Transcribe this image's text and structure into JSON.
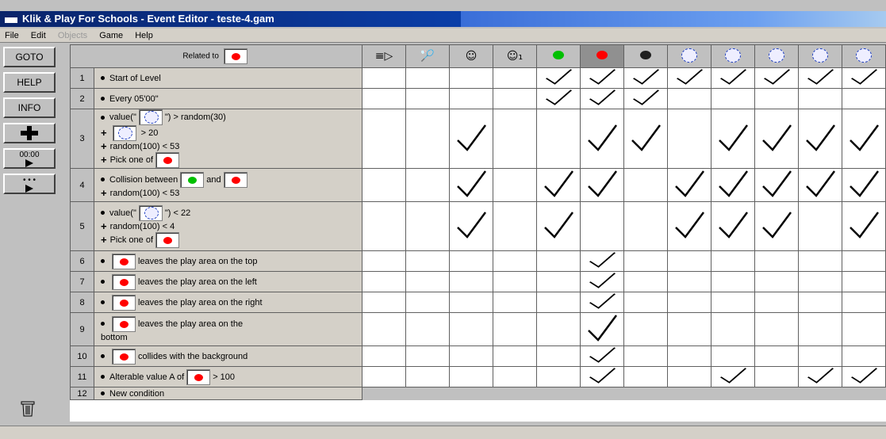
{
  "window": {
    "title": "Klik & Play For Schools - Event Editor - teste-4.gam"
  },
  "menu": [
    {
      "label": "File",
      "enabled": true
    },
    {
      "label": "Edit",
      "enabled": true
    },
    {
      "label": "Objects",
      "enabled": false
    },
    {
      "label": "Game",
      "enabled": true
    },
    {
      "label": "Help",
      "enabled": true
    }
  ],
  "toolbar": {
    "goto_label": "GOTO",
    "help_label": "HELP",
    "info_label": "INFO",
    "timer_label": "00:00",
    "dots_label": "• • •"
  },
  "header": {
    "related_to_label": "Related to"
  },
  "objects": [
    {
      "name": "speaker-icon",
      "glyph": "≡▷"
    },
    {
      "name": "racket-icon",
      "glyph": "🏸"
    },
    {
      "name": "player-icon",
      "glyph": "☺"
    },
    {
      "name": "lives-icon",
      "glyph": "☺₁"
    },
    {
      "name": "green-ball-icon",
      "color": "#00c000"
    },
    {
      "name": "red-ball-icon",
      "color": "#ff0000"
    },
    {
      "name": "black-ball-icon",
      "color": "#202020"
    },
    {
      "name": "counter-icon-1",
      "glyph": "ring"
    },
    {
      "name": "counter-icon-2",
      "glyph": "ring"
    },
    {
      "name": "counter-icon-3",
      "glyph": "ring"
    },
    {
      "name": "counter-icon-4",
      "glyph": "ring"
    },
    {
      "name": "counter-icon-5",
      "glyph": "ring"
    }
  ],
  "colors": {
    "red": "#ff0000",
    "green": "#00c000"
  },
  "rows": [
    {
      "num": "1",
      "lines": [
        {
          "prefix": "bullet",
          "parts": [
            "Start of Level"
          ]
        }
      ],
      "checks": [
        0,
        0,
        0,
        0,
        1,
        1,
        1,
        1,
        1,
        1,
        1,
        1
      ]
    },
    {
      "num": "2",
      "lines": [
        {
          "prefix": "bullet",
          "parts": [
            "Every 05'00\""
          ]
        }
      ],
      "checks": [
        0,
        0,
        0,
        0,
        1,
        1,
        1,
        0,
        0,
        0,
        0,
        0
      ]
    },
    {
      "num": "3",
      "lines": [
        {
          "prefix": "bullet",
          "parts": [
            "value(\"",
            {
              "icon": "ring"
            },
            "\") > random(30)"
          ]
        },
        {
          "prefix": "plus",
          "parts": [
            {
              "icon": "ring"
            },
            " > 20"
          ]
        },
        {
          "prefix": "plus",
          "parts": [
            "random(100) < 53"
          ]
        },
        {
          "prefix": "plus",
          "parts": [
            "Pick one of",
            {
              "icon": "red"
            }
          ]
        }
      ],
      "checks": [
        0,
        0,
        1,
        0,
        0,
        1,
        1,
        0,
        1,
        1,
        1,
        1
      ]
    },
    {
      "num": "4",
      "lines": [
        {
          "prefix": "bullet",
          "parts": [
            "Collision between",
            {
              "icon": "green"
            },
            "and",
            {
              "icon": "red"
            }
          ]
        },
        {
          "prefix": "plus",
          "parts": [
            "random(100) < 53"
          ]
        }
      ],
      "checks": [
        0,
        0,
        1,
        0,
        1,
        1,
        0,
        1,
        1,
        1,
        1,
        1
      ]
    },
    {
      "num": "5",
      "lines": [
        {
          "prefix": "bullet",
          "parts": [
            "value(\"",
            {
              "icon": "ring"
            },
            "\") < 22"
          ]
        },
        {
          "prefix": "plus",
          "parts": [
            "random(100) < 4"
          ]
        },
        {
          "prefix": "plus",
          "parts": [
            "Pick one of",
            {
              "icon": "red"
            }
          ]
        }
      ],
      "checks": [
        0,
        0,
        1,
        0,
        1,
        0,
        0,
        1,
        1,
        1,
        0,
        1
      ]
    },
    {
      "num": "6",
      "lines": [
        {
          "prefix": "bullet",
          "parts": [
            {
              "icon": "red"
            },
            "leaves the play area on the top"
          ]
        }
      ],
      "checks": [
        0,
        0,
        0,
        0,
        0,
        1,
        0,
        0,
        0,
        0,
        0,
        0
      ]
    },
    {
      "num": "7",
      "lines": [
        {
          "prefix": "bullet",
          "parts": [
            {
              "icon": "red"
            },
            "leaves the play area on the left"
          ]
        }
      ],
      "checks": [
        0,
        0,
        0,
        0,
        0,
        1,
        0,
        0,
        0,
        0,
        0,
        0
      ]
    },
    {
      "num": "8",
      "lines": [
        {
          "prefix": "bullet",
          "parts": [
            {
              "icon": "red"
            },
            "leaves the play area on the right"
          ]
        }
      ],
      "checks": [
        0,
        0,
        0,
        0,
        0,
        1,
        0,
        0,
        0,
        0,
        0,
        0
      ]
    },
    {
      "num": "9",
      "lines": [
        {
          "prefix": "bullet",
          "parts": [
            {
              "icon": "red"
            },
            "leaves the play area on the"
          ]
        },
        {
          "prefix": "none",
          "parts": [
            "bottom"
          ]
        }
      ],
      "checks": [
        0,
        0,
        0,
        0,
        0,
        1,
        0,
        0,
        0,
        0,
        0,
        0
      ]
    },
    {
      "num": "10",
      "lines": [
        {
          "prefix": "bullet",
          "parts": [
            {
              "icon": "red"
            },
            "collides with the background"
          ]
        }
      ],
      "checks": [
        0,
        0,
        0,
        0,
        0,
        1,
        0,
        0,
        0,
        0,
        0,
        0
      ]
    },
    {
      "num": "11",
      "lines": [
        {
          "prefix": "bullet",
          "parts": [
            "Alterable value A of",
            {
              "icon": "red"
            },
            "> 100"
          ]
        }
      ],
      "checks": [
        0,
        0,
        0,
        0,
        0,
        1,
        0,
        0,
        1,
        0,
        1,
        1
      ]
    },
    {
      "num": "12",
      "lines": [
        {
          "prefix": "bullet",
          "parts": [
            "New condition"
          ]
        }
      ],
      "checks": null
    }
  ]
}
